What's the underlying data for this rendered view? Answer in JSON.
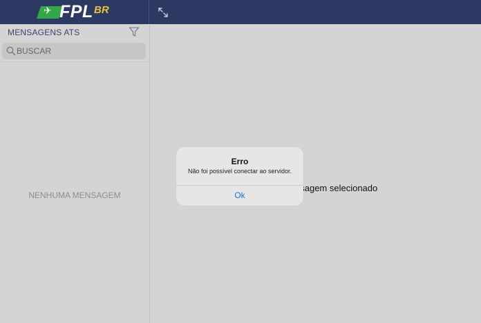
{
  "header": {
    "logo_text": "FPL",
    "logo_suffix": "BR",
    "expand_icon": "expand-arrows-icon",
    "colors": {
      "bar": "#2c3a63",
      "logo_green": "#33a84a",
      "logo_gold": "#e8c23a"
    }
  },
  "sidebar": {
    "title": "MENSAGENS ATS",
    "filter_icon": "funnel-icon",
    "search": {
      "placeholder": "BUSCAR",
      "value": ""
    },
    "empty_text": "NENHUMA MENSAGEM"
  },
  "main": {
    "message_partial": "nsagem selecionado"
  },
  "alert": {
    "title": "Erro",
    "message": "Não foi possível conectar ao servidor.",
    "ok_label": "Ok",
    "colors": {
      "button": "#1a73d6"
    }
  }
}
